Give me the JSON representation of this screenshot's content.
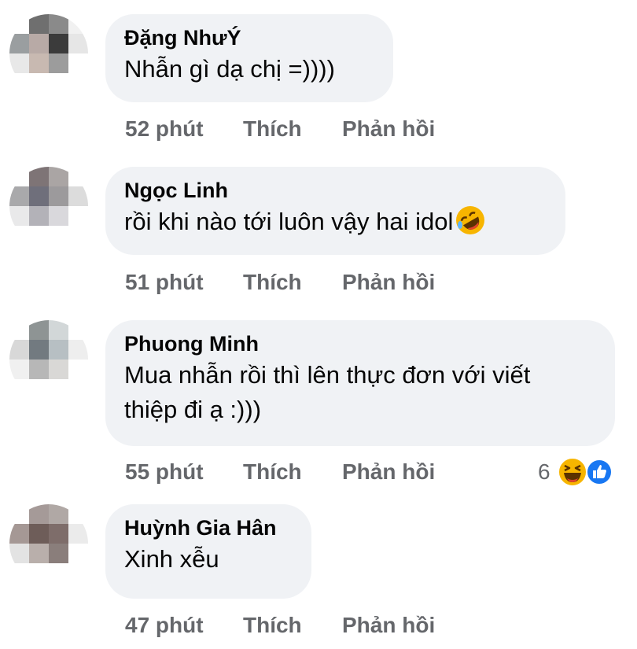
{
  "comments": [
    {
      "name": "Đặng NhưÝ",
      "text": "Nhẫn gì dạ chị =))))",
      "time": "52 phút",
      "like": "Thích",
      "reply": "Phản hồi",
      "avatar_colors": [
        "#ffffff",
        "#6f6f6f",
        "#8a8a8a",
        "#f1f1f1",
        "#9a9ea0",
        "#b8aaa6",
        "#3b3b3b",
        "#e6e6e6",
        "#e8e8e8",
        "#c8b9b1",
        "#9c9c9c",
        "#ffffff",
        "#ffffff",
        "#ffffff",
        "#ffffff",
        "#ffffff"
      ]
    },
    {
      "name": "Ngọc Linh",
      "text": "rồi khi nào tới luôn vậy hai idol",
      "time": "51 phút",
      "like": "Thích",
      "reply": "Phản hồi",
      "emoji": "rolling-laughing",
      "avatar_colors": [
        "#ffffff",
        "#7e7476",
        "#aaa5a4",
        "#ffffff",
        "#a9a9ab",
        "#6f6f7b",
        "#9c9a9c",
        "#dcdcdc",
        "#e9e9ea",
        "#b3b2b8",
        "#d9d8dc",
        "#ffffff",
        "#ffffff",
        "#ffffff",
        "#ffffff",
        "#ffffff"
      ]
    },
    {
      "name": "Phuong Minh",
      "text_lines": [
        "Mua nhẫn rồi thì lên thực đơn với viết",
        "thiệp đi ạ :)))"
      ],
      "time": "55 phút",
      "like": "Thích",
      "reply": "Phản hồi",
      "reaction_count": "6",
      "avatar_colors": [
        "#ffffff",
        "#8e9494",
        "#d2d7d8",
        "#ffffff",
        "#d8d8d8",
        "#727a80",
        "#b7bfc3",
        "#eeeeee",
        "#f0f0f0",
        "#b7b7b7",
        "#d9d8d6",
        "#ffffff",
        "#ffffff",
        "#ffffff",
        "#ffffff",
        "#ffffff"
      ]
    },
    {
      "name": "Huỳnh Gia Hân",
      "text": "Xinh xễu",
      "time": "47 phút",
      "like": "Thích",
      "reply": "Phản hồi",
      "avatar_colors": [
        "#ffffff",
        "#a59a98",
        "#b0a8a5",
        "#ffffff",
        "#a59895",
        "#6e5d59",
        "#7e6d6a",
        "#ebebeb",
        "#e3e3e3",
        "#b9afab",
        "#8a7e7b",
        "#ffffff",
        "#ffffff",
        "#ffffff",
        "#ffffff",
        "#ffffff"
      ]
    }
  ]
}
